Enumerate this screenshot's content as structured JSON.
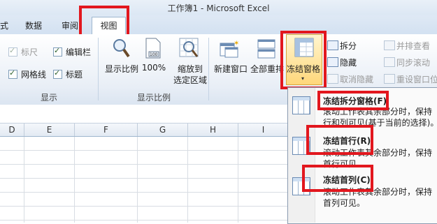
{
  "window": {
    "title": "工作簿1  -  Microsoft Excel"
  },
  "tabs": [
    {
      "label": "式"
    },
    {
      "label": "数据"
    },
    {
      "label": "审阅"
    },
    {
      "label": "视图",
      "active": true
    }
  ],
  "ribbon": {
    "show_group": {
      "label": "显示",
      "checkboxes": [
        {
          "label": "标尺",
          "checked": true,
          "disabled": true
        },
        {
          "label": "编辑栏",
          "checked": true,
          "disabled": false
        },
        {
          "label": "网格线",
          "checked": true,
          "disabled": false
        },
        {
          "label": "标题",
          "checked": true,
          "disabled": false
        }
      ]
    },
    "zoom_group": {
      "label": "显示比例",
      "buttons": [
        {
          "label": "显示比例",
          "icon": "magnifier-icon"
        },
        {
          "label": "100%",
          "icon": "page-100-icon"
        },
        {
          "label_line1": "缩放到",
          "label_line2": "选定区域",
          "icon": "zoom-selection-icon"
        }
      ]
    },
    "window_group": {
      "buttons": [
        {
          "label": "新建窗口",
          "icon": "new-window-icon"
        },
        {
          "label": "全部重排",
          "icon": "arrange-all-icon"
        },
        {
          "label": "冻结窗格",
          "icon": "freeze-panes-icon",
          "highlighted": true
        }
      ],
      "small_buttons": [
        {
          "label": "拆分",
          "disabled": false
        },
        {
          "label": "隐藏",
          "disabled": false
        },
        {
          "label": "取消隐藏",
          "disabled": true
        },
        {
          "label": "并排查看",
          "disabled": true
        },
        {
          "label": "同步滚动",
          "disabled": true
        },
        {
          "label": "重设窗口位",
          "disabled": true
        }
      ]
    }
  },
  "grid": {
    "columns": [
      "D",
      "E",
      "F",
      "G",
      "H",
      "I"
    ]
  },
  "freeze_menu": {
    "items": [
      {
        "title": "冻结拆分窗格(F)",
        "desc_line1": "滚动工作表其余部分时，保持",
        "desc_line2": "行和列可见(基于当前的选择)。"
      },
      {
        "title": "冻结首行(R)",
        "desc_line1": "滚动工作表其余部分时，保持",
        "desc_line2": "首行可见。"
      },
      {
        "title": "冻结首列(C)",
        "desc_line1": "滚动工作表其余部分时，保持",
        "desc_line2": "首列可见。"
      }
    ]
  },
  "colors": {
    "highlight_box": "#e2171e",
    "ribbon_bg": "#e8eef6",
    "button_hover": "#ffd77a"
  }
}
